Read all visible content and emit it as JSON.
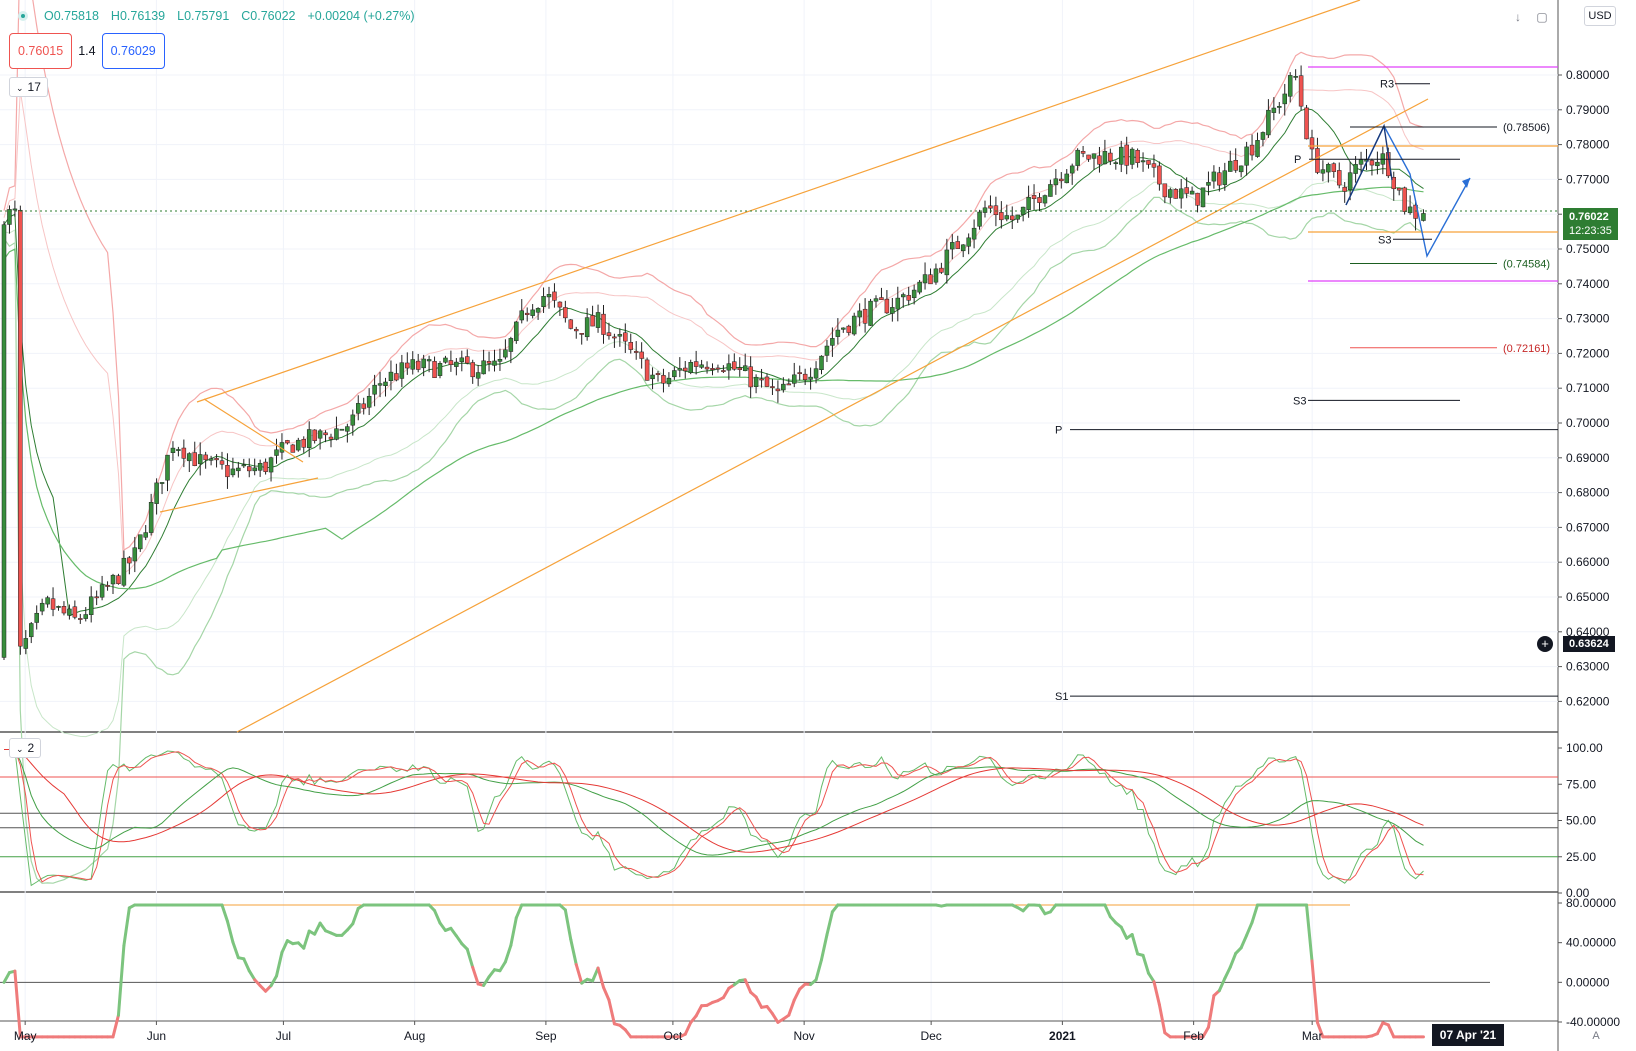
{
  "header": {
    "ohlc": {
      "open": "O0.75818",
      "high": "H0.76139",
      "low": "L0.75791",
      "close": "C0.76022",
      "change": "+0.00204 (+0.27%)"
    },
    "sell_price": "0.76015",
    "spread": "1.4",
    "buy_price": "0.76029",
    "indicators_count": "17",
    "currency": "USD"
  },
  "price_scale": {
    "labels": [
      "0.80000",
      "0.79000",
      "0.78000",
      "0.77000",
      "0.76000",
      "0.75000",
      "0.74000",
      "0.73000",
      "0.72000",
      "0.71000",
      "0.70000",
      "0.69000",
      "0.68000",
      "0.67000",
      "0.66000",
      "0.65000",
      "0.64000",
      "0.63000",
      "0.62000"
    ],
    "last_price": "0.76022",
    "countdown": "12:23:35",
    "cursor_price": "0.63624"
  },
  "stoch_pane": {
    "label": "2",
    "levels": [
      "100.00",
      "75.00",
      "50.00",
      "25.00",
      "0.00"
    ]
  },
  "osc_pane": {
    "levels": [
      "80.00000",
      "40.00000",
      "0.00000",
      "-40.00000"
    ]
  },
  "time_axis": {
    "labels": [
      "May",
      "Jun",
      "Jul",
      "Aug",
      "Sep",
      "Oct",
      "Nov",
      "Dec",
      "2021",
      "Feb",
      "Mar"
    ],
    "cursor_date": "07 Apr '21",
    "auto_label": "A"
  },
  "annotations": {
    "level_labels": [
      "R3",
      "(0.78506)",
      "P",
      "S3",
      "(0.74584)",
      "(0.72161)",
      "S3",
      "P",
      "S1"
    ]
  },
  "colors": {
    "up": "#388e3c",
    "down": "#ef5350",
    "channel": "#f6a23a",
    "band_upper": "#f4a8a8",
    "band_lower": "#a5d6a7",
    "ma": "#66bb6a",
    "pivot_magenta": "#e040fb",
    "arrow": "#2a6fd6"
  },
  "chart_data": [
    {
      "type": "candlestick",
      "title": "",
      "x_labels": [
        "May",
        "Jun",
        "Jul",
        "Aug",
        "Sep",
        "Oct",
        "Nov",
        "Dec",
        "2021",
        "Feb",
        "Mar"
      ],
      "ylim": [
        0.612,
        0.818
      ],
      "grid": true,
      "close_anchors": [
        [
          "2020-04-29",
          0.632
        ],
        [
          "2020-05-06",
          0.648
        ],
        [
          "2020-05-13",
          0.643
        ],
        [
          "2020-05-20",
          0.652
        ],
        [
          "2020-05-27",
          0.662
        ],
        [
          "2020-06-05",
          0.695
        ],
        [
          "2020-06-12",
          0.688
        ],
        [
          "2020-06-19",
          0.686
        ],
        [
          "2020-06-26",
          0.687
        ],
        [
          "2020-07-03",
          0.694
        ],
        [
          "2020-07-10",
          0.696
        ],
        [
          "2020-07-17",
          0.7
        ],
        [
          "2020-07-24",
          0.712
        ],
        [
          "2020-07-31",
          0.716
        ],
        [
          "2020-08-07",
          0.716
        ],
        [
          "2020-08-14",
          0.716
        ],
        [
          "2020-08-21",
          0.716
        ],
        [
          "2020-08-28",
          0.734
        ],
        [
          "2020-09-01",
          0.737
        ],
        [
          "2020-09-07",
          0.727
        ],
        [
          "2020-09-14",
          0.729
        ],
        [
          "2020-09-21",
          0.72
        ],
        [
          "2020-09-28",
          0.711
        ],
        [
          "2020-10-05",
          0.717
        ],
        [
          "2020-10-12",
          0.718
        ],
        [
          "2020-10-19",
          0.713
        ],
        [
          "2020-10-26",
          0.708
        ],
        [
          "2020-11-02",
          0.715
        ],
        [
          "2020-11-09",
          0.727
        ],
        [
          "2020-11-16",
          0.732
        ],
        [
          "2020-11-23",
          0.735
        ],
        [
          "2020-11-30",
          0.741
        ],
        [
          "2020-12-07",
          0.751
        ],
        [
          "2020-12-14",
          0.762
        ],
        [
          "2020-12-21",
          0.758
        ],
        [
          "2020-12-28",
          0.768
        ],
        [
          "2021-01-04",
          0.776
        ],
        [
          "2021-01-11",
          0.777
        ],
        [
          "2021-01-18",
          0.776
        ],
        [
          "2021-01-25",
          0.768
        ],
        [
          "2021-02-01",
          0.764
        ],
        [
          "2021-02-08",
          0.772
        ],
        [
          "2021-02-15",
          0.78
        ],
        [
          "2021-02-22",
          0.794
        ],
        [
          "2021-02-25",
          0.8
        ],
        [
          "2021-03-01",
          0.776
        ],
        [
          "2021-03-08",
          0.768
        ],
        [
          "2021-03-12",
          0.774
        ],
        [
          "2021-03-17",
          0.777
        ],
        [
          "2021-03-19",
          0.774
        ],
        [
          "2021-03-23",
          0.762
        ],
        [
          "2021-03-26",
          0.76
        ]
      ],
      "last": {
        "open": 0.75818,
        "high": 0.76139,
        "low": 0.75791,
        "close": 0.76022
      },
      "pivot_levels": [
        {
          "label": "R3",
          "value": 0.7975
        },
        {
          "label": "(0.78506)",
          "value": 0.78506
        },
        {
          "label": "P",
          "value": 0.7758
        },
        {
          "label": "S3",
          "value": 0.7528
        },
        {
          "label": "(0.74584)",
          "value": 0.74584
        },
        {
          "label": "(0.72161)",
          "value": 0.72161
        },
        {
          "label": "S3",
          "value": 0.7065
        },
        {
          "label": "P",
          "value": 0.6981
        },
        {
          "label": "S1",
          "value": 0.6215
        }
      ]
    },
    {
      "type": "line",
      "title": "",
      "ylim": [
        0,
        100
      ],
      "levels": [
        100,
        75,
        50,
        25,
        0
      ],
      "series": [
        {
          "values": []
        },
        {
          "values": []
        }
      ]
    },
    {
      "type": "line",
      "title": "",
      "ylim": [
        -60,
        85
      ],
      "levels": [
        80,
        40,
        0,
        -40
      ],
      "series": [
        {
          "values": []
        }
      ]
    }
  ]
}
